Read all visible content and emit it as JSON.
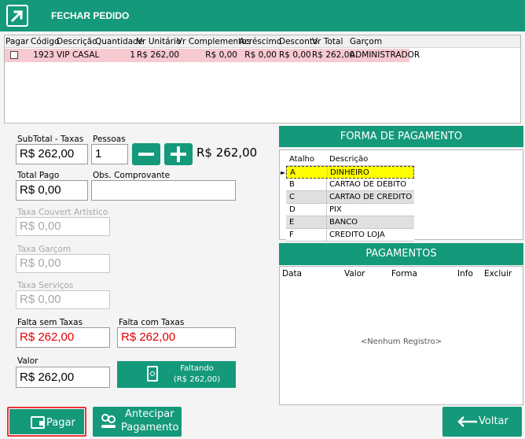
{
  "header": {
    "title": "FECHAR PEDIDO"
  },
  "grid": {
    "columns": [
      "Pagar",
      "Código",
      "Descrição",
      "Quantidade",
      "Vr Unitário",
      "Vr Complementos",
      "Acréscimo",
      "Desconto",
      "Vr Total",
      "Garçom"
    ],
    "rows": [
      {
        "pagar": false,
        "codigo": "1923",
        "descricao": "VIP CASAL",
        "quantidade": "1",
        "vr_unitario": "R$ 262,00",
        "vr_complementos": "R$ 0,00",
        "acrescimo": "R$ 0,00",
        "desconto": "R$ 0,00",
        "vr_total": "R$ 262,00",
        "garcom": "ADMINISTRADOR"
      }
    ]
  },
  "form": {
    "subtotal_label": "SubTotal - Taxas",
    "subtotal_value": "R$ 262,00",
    "pessoas_label": "Pessoas",
    "pessoas_value": "1",
    "per_person_total": "R$ 262,00",
    "total_pago_label": "Total Pago",
    "total_pago_value": "R$ 0,00",
    "obs_label": "Obs. Comprovante",
    "obs_value": "",
    "couvert_label": "Taxa Couvert Artístico",
    "couvert_value": "R$ 0,00",
    "garcom_label": "Taxa Garçom",
    "garcom_value": "R$ 0,00",
    "servicos_label": "Taxa Serviços",
    "servicos_value": "R$ 0,00",
    "falta_sem_label": "Falta sem Taxas",
    "falta_sem_value": "R$ 262,00",
    "falta_com_label": "Falta com Taxas",
    "falta_com_value": "R$ 262,00",
    "valor_label": "Valor",
    "valor_value": "R$ 262,00",
    "faltando_label": "Faltando",
    "faltando_value": "(R$ 262,00)"
  },
  "forma_pagamento": {
    "title": "FORMA DE PAGAMENTO",
    "columns": [
      "Atalho",
      "Descrição"
    ],
    "rows": [
      {
        "atalho": "A",
        "descricao": "DINHEIRO",
        "selected": true
      },
      {
        "atalho": "B",
        "descricao": "CARTAO DE DEBITO",
        "selected": false
      },
      {
        "atalho": "C",
        "descricao": "CARTAO DE CREDITO",
        "selected": false
      },
      {
        "atalho": "D",
        "descricao": "PIX",
        "selected": false
      },
      {
        "atalho": "E",
        "descricao": "BANCO",
        "selected": false
      },
      {
        "atalho": "F",
        "descricao": "CREDITO LOJA",
        "selected": false
      }
    ]
  },
  "pagamentos": {
    "title": "PAGAMENTOS",
    "columns": [
      "Data",
      "Valor",
      "Forma",
      "Info",
      "Excluir"
    ],
    "empty_text": "<Nenhum Registro>"
  },
  "buttons": {
    "pagar": "Pagar",
    "antecipar_line1": "Antecipar",
    "antecipar_line2": "Pagamento",
    "voltar": "Voltar"
  },
  "colors": {
    "accent": "#14997a",
    "row_highlight": "#f7c9d1",
    "selected_row": "#ffff00",
    "missing_value": "#e00000"
  }
}
